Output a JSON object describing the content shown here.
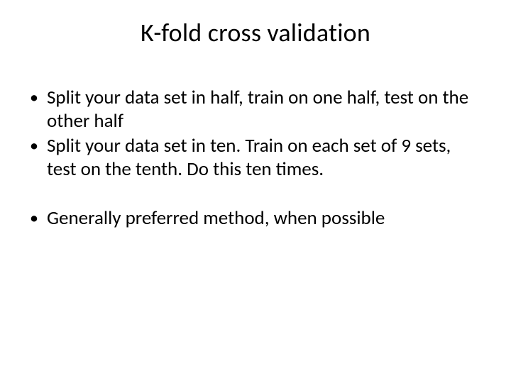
{
  "slide": {
    "title": "K-fold cross validation",
    "bullets_group1": [
      "Split your data set in half, train on one half, test on the other half",
      "Split your data set in ten. Train on each set of 9 sets, test on the tenth. Do this ten times."
    ],
    "bullets_group2": [
      "Generally preferred method, when possible"
    ]
  }
}
